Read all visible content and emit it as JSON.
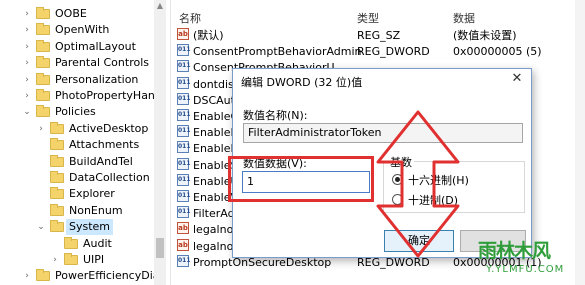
{
  "tree": {
    "items": [
      {
        "label": "OOBE",
        "state": "collapsed"
      },
      {
        "label": "OpenWith",
        "state": "collapsed"
      },
      {
        "label": "OptimalLayout",
        "state": "collapsed"
      },
      {
        "label": "Parental Controls",
        "state": "collapsed"
      },
      {
        "label": "Personalization",
        "state": "collapsed"
      },
      {
        "label": "PhotoPropertyHanc",
        "state": "collapsed"
      },
      {
        "label": "Policies",
        "state": "expanded"
      },
      {
        "label": "ActiveDesktop",
        "state": "collapsed"
      },
      {
        "label": "Attachments",
        "state": "none"
      },
      {
        "label": "BuildAndTel",
        "state": "none"
      },
      {
        "label": "DataCollection",
        "state": "none"
      },
      {
        "label": "Explorer",
        "state": "none"
      },
      {
        "label": "NonEnum",
        "state": "none"
      },
      {
        "label": "System",
        "state": "expanded",
        "selected": true
      },
      {
        "label": "Audit",
        "state": "none"
      },
      {
        "label": "UIPI",
        "state": "collapsed"
      },
      {
        "label": "PowerEfficiencyDiag",
        "state": "collapsed"
      }
    ]
  },
  "list": {
    "headers": {
      "name": "名称",
      "type": "类型",
      "data": "数据"
    },
    "rows": [
      {
        "name": "(默认)",
        "type": "REG_SZ",
        "data": "(数值未设置)",
        "kind": "sz"
      },
      {
        "name": "ConsentPromptBehaviorAdmin",
        "type": "REG_DWORD",
        "data": "0x00000005 (5)",
        "kind": "dw"
      },
      {
        "name": "ConsentPromptBehaviorU",
        "type": "",
        "data": "",
        "kind": "dw"
      },
      {
        "name": "dontdisp",
        "type": "",
        "data": "",
        "kind": "dw"
      },
      {
        "name": "DSCAuto",
        "type": "",
        "data": "",
        "kind": "dw"
      },
      {
        "name": "EnableCu",
        "type": "",
        "data": "",
        "kind": "dw"
      },
      {
        "name": "EnableIn",
        "type": "",
        "data": "",
        "kind": "dw"
      },
      {
        "name": "EnableLU",
        "type": "",
        "data": "",
        "kind": "dw"
      },
      {
        "name": "EnableSe",
        "type": "",
        "data": "",
        "kind": "dw"
      },
      {
        "name": "EnableUI",
        "type": "",
        "data": "",
        "kind": "dw"
      },
      {
        "name": "EnableVi",
        "type": "",
        "data": "",
        "kind": "dw"
      },
      {
        "name": "FilterAdm",
        "type": "",
        "data": "",
        "kind": "dw"
      },
      {
        "name": "legalnoti",
        "type": "",
        "data": "",
        "kind": "sz"
      },
      {
        "name": "legalnoti",
        "type": "",
        "data": "",
        "kind": "sz"
      },
      {
        "name": "PromptOnSecureDesktop",
        "type": "REG_DWORD",
        "data": "0x00000001 (1)",
        "kind": "dw"
      }
    ]
  },
  "dialog": {
    "title": "编辑 DWORD (32 位)值",
    "close_glyph": "✕",
    "name_label": "数值名称(N):",
    "name_value": "FilterAdministratorToken",
    "value_label": "数值数据(V):",
    "value_value": "1",
    "base_label": "基数",
    "radio_hex": "十六进制(H)",
    "radio_dec": "十进制(D)",
    "hex_selected": true,
    "ok_label": "确定"
  },
  "watermark": {
    "brand": "雨林木风",
    "url": "Y.YLMFU.COM"
  },
  "colors": {
    "annotation": "#e03030",
    "watermark": "#2f9e3a",
    "selection": "#cce8ff"
  }
}
